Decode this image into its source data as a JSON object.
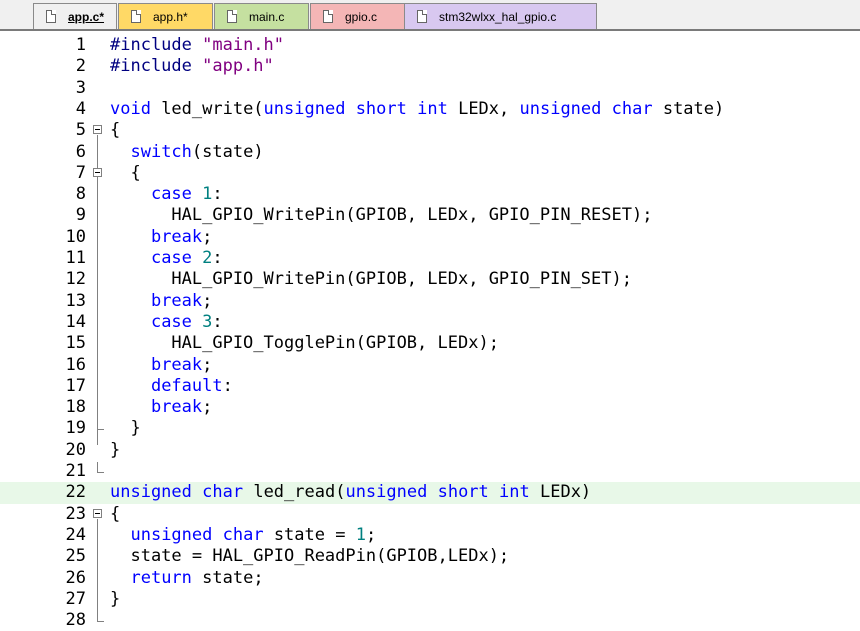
{
  "tabs": [
    {
      "label": "app.c*",
      "color": "#f0f0f0",
      "active": true
    },
    {
      "label": "app.h*",
      "color": "#ffd966",
      "active": false
    },
    {
      "label": "main.c",
      "color": "#c5e0a0",
      "active": false
    },
    {
      "label": "gpio.c",
      "color": "#f4b6b6",
      "active": false
    },
    {
      "label": "stm32wlxx_hal_gpio.c",
      "color": "#d8c8f0",
      "active": false
    }
  ],
  "lines": [
    {
      "n": "1",
      "code": "#include \"main.h\""
    },
    {
      "n": "2",
      "code": "#include \"app.h\""
    },
    {
      "n": "3",
      "code": ""
    },
    {
      "n": "4",
      "code": "void led_write(unsigned short int LEDx, unsigned char state)"
    },
    {
      "n": "5",
      "code": "{"
    },
    {
      "n": "6",
      "code": "  switch(state)"
    },
    {
      "n": "7",
      "code": "  {"
    },
    {
      "n": "8",
      "code": "    case 1:"
    },
    {
      "n": "9",
      "code": "      HAL_GPIO_WritePin(GPIOB, LEDx, GPIO_PIN_RESET);"
    },
    {
      "n": "10",
      "code": "    break;"
    },
    {
      "n": "11",
      "code": "    case 2:"
    },
    {
      "n": "12",
      "code": "      HAL_GPIO_WritePin(GPIOB, LEDx, GPIO_PIN_SET);"
    },
    {
      "n": "13",
      "code": "    break;"
    },
    {
      "n": "14",
      "code": "    case 3:"
    },
    {
      "n": "15",
      "code": "      HAL_GPIO_TogglePin(GPIOB, LEDx);"
    },
    {
      "n": "16",
      "code": "    break;"
    },
    {
      "n": "17",
      "code": "    default:"
    },
    {
      "n": "18",
      "code": "    break;"
    },
    {
      "n": "19",
      "code": "  }"
    },
    {
      "n": "20",
      "code": "}"
    },
    {
      "n": "21",
      "code": ""
    },
    {
      "n": "22",
      "code": "unsigned char led_read(unsigned short int LEDx)"
    },
    {
      "n": "23",
      "code": "{"
    },
    {
      "n": "24",
      "code": "  unsigned char state = 1;"
    },
    {
      "n": "25",
      "code": "  state = HAL_GPIO_ReadPin(GPIOB,LEDx);"
    },
    {
      "n": "26",
      "code": "  return state;"
    },
    {
      "n": "27",
      "code": "}"
    },
    {
      "n": "28",
      "code": ""
    }
  ],
  "highlighted_line": "22",
  "colors": {
    "keyword": "#0000ff",
    "number": "#008080",
    "string": "#800080",
    "highlight": "#e8f8e8"
  }
}
